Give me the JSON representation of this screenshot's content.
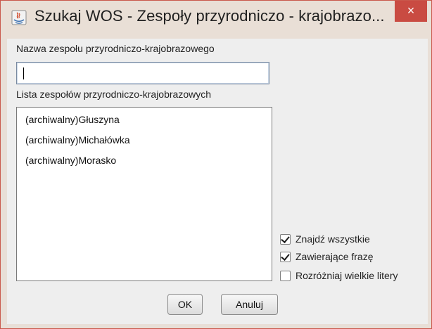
{
  "window": {
    "title": "Szukaj WOS - Zespoły przyrodniczo - krajobrazo...",
    "close_glyph": "×",
    "icon": "java-app-icon",
    "border_color": "#c9584c",
    "close_color": "#c94b42"
  },
  "form": {
    "name_label": "Nazwa zespołu przyrodniczo-krajobrazowego",
    "name_value": "",
    "list_label": "Lista zespołów przyrodniczo-krajobrazowych",
    "list_items": [
      "(archiwalny)Głuszyna",
      "(archiwalny)Michałówka",
      "(archiwalny)Morasko"
    ]
  },
  "options": [
    {
      "label": "Znajdź wszystkie",
      "checked": true
    },
    {
      "label": "Zawierające frazę",
      "checked": true
    },
    {
      "label": "Rozróżniaj wielkie litery",
      "checked": false
    }
  ],
  "buttons": {
    "ok": "OK",
    "cancel": "Anuluj"
  }
}
